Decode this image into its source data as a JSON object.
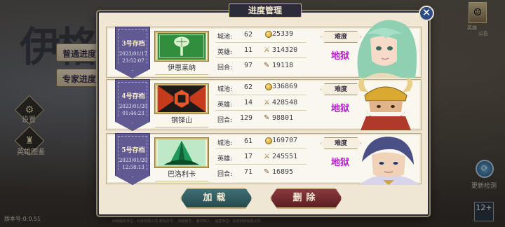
{
  "background": {
    "title_glyphs": "伊格",
    "mode_buttons": [
      "普通进度",
      "专家进度"
    ],
    "side_menu": [
      {
        "label": "设置",
        "icon": "gear-icon"
      },
      {
        "label": "英雄图鉴",
        "icon": "hero-book-icon"
      }
    ],
    "top_right_avatar_label": "英雄",
    "top_right_avatar_sub": "公告",
    "update_label": "更新检测",
    "age_rating": "12+",
    "age_sub": "CADPA\n适龄提示",
    "version": "版本号:0.0.51",
    "footer": "出版服务单位：科技有限公司  审批文号：  出版物号：  著作权人：  运营单位：信息科技有限公司"
  },
  "modal": {
    "title": "进度管理",
    "close_label": "✕",
    "labels": {
      "pool": "城池:",
      "heroes": "英雄:",
      "rounds": "回合:",
      "difficulty": "难度"
    },
    "slots": [
      {
        "slot": "3号存档",
        "date": "2023/01/17",
        "time": "23:52:07",
        "region": "伊恩莱纳",
        "pool": "62",
        "heroes": "11",
        "rounds": "97",
        "gold": "25339",
        "food": "314320",
        "wood": "19118",
        "difficulty": "地狱",
        "emblem_color": "#2f8f3d",
        "portrait": "elf-girl"
      },
      {
        "slot": "4号存档",
        "date": "2023/01/20",
        "time": "01:44:23",
        "region": "钢铎山",
        "pool": "62",
        "heroes": "14",
        "rounds": "129",
        "gold": "336869",
        "food": "428548",
        "wood": "98801",
        "difficulty": "地狱",
        "emblem_color": "#c63b1c",
        "portrait": "dwarf-king"
      },
      {
        "slot": "5号存档",
        "date": "2023/01/20",
        "time": "12:58:13",
        "region": "巴洛利卡",
        "pool": "61",
        "heroes": "17",
        "rounds": "71",
        "gold": "169707",
        "food": "245551",
        "wood": "16895",
        "difficulty": "地狱",
        "emblem_color": "#1f9a5a",
        "portrait": "mage"
      }
    ],
    "load_label": "加载",
    "delete_label": "删除"
  }
}
